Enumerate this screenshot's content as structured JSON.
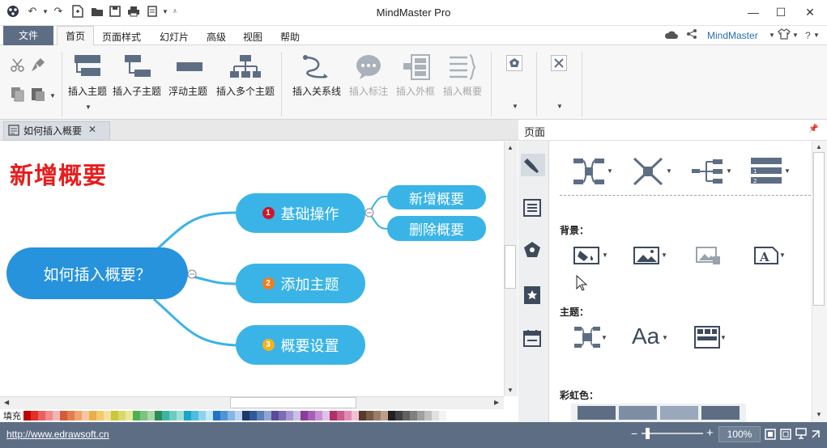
{
  "app": {
    "title": "MindMaster Pro",
    "account": "MindMaster"
  },
  "menu": {
    "file": "文件",
    "items": [
      "首页",
      "页面样式",
      "幻灯片",
      "高级",
      "视图",
      "帮助"
    ]
  },
  "ribbon": {
    "insert_topic": "插入主题",
    "insert_subtopic": "插入子主题",
    "floating_topic": "浮动主题",
    "insert_multiple": "插入多个主题",
    "insert_relation": "插入关系线",
    "insert_callout": "插入标注",
    "insert_boundary": "插入外框",
    "insert_summary": "插入概要"
  },
  "document_tab": "如何插入概要",
  "canvas": {
    "heading": "新增概要",
    "central": "如何插入概要？",
    "topics": [
      {
        "num": "1",
        "label": "基础操作",
        "color": "#d0152b"
      },
      {
        "num": "2",
        "label": "添加主题",
        "color": "#f07d1d"
      },
      {
        "num": "3",
        "label": "概要设置",
        "color": "#f4b31c"
      }
    ],
    "subtopics": [
      "新增概要",
      "删除概要"
    ]
  },
  "panel": {
    "header": "页面",
    "background_label": "背景：",
    "theme_label": "主题：",
    "rainbow_label": "彩虹色："
  },
  "palette": {
    "label": "填充",
    "colors": [
      "#c00000",
      "#e0302c",
      "#ec5f5f",
      "#f28b8b",
      "#f6b3b3",
      "#d45b3b",
      "#e27e4e",
      "#f0a36c",
      "#f6c7a0",
      "#e8b04a",
      "#f1cb6c",
      "#f6de9c",
      "#c8c83a",
      "#d9d96a",
      "#e8e89a",
      "#4caf50",
      "#7cc47f",
      "#a8d8aa",
      "#2e8b57",
      "#3cb3a4",
      "#6cccbf",
      "#9ee0d7",
      "#1ca3c9",
      "#4fbce0",
      "#8dd3ee",
      "#c3e8f6",
      "#2473c4",
      "#4f94d8",
      "#85b6e8",
      "#b9d4f3",
      "#1b3a6b",
      "#2e5a96",
      "#5b7fb8",
      "#8ea6d2",
      "#5a4a9c",
      "#7c6cb8",
      "#a396d0",
      "#c9c0e4",
      "#8a3c9c",
      "#a95eb8",
      "#c690d2",
      "#e0c0e8",
      "#b0306a",
      "#cc5a8c",
      "#e08cb0",
      "#f0c0d6",
      "#5a3a2a",
      "#7a5a46",
      "#9a7c68",
      "#bca08c",
      "#202020",
      "#404040",
      "#606060",
      "#808080",
      "#a0a0a0",
      "#c0c0c0",
      "#e0e0e0",
      "#f4f4f4"
    ]
  },
  "status": {
    "url": "http://www.edrawsoft.cn",
    "zoom": "100%"
  },
  "colors": {
    "accent": "#5d6e84",
    "node": "#3ab4e6",
    "central": "#2793dc",
    "heading": "#e81c1c"
  }
}
